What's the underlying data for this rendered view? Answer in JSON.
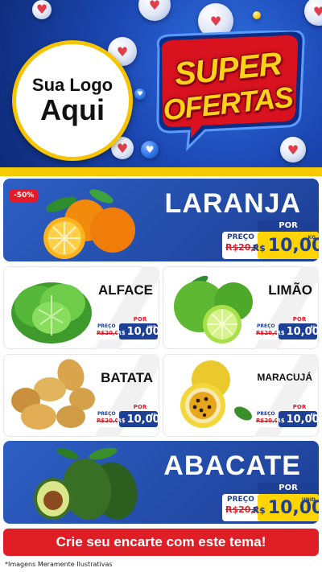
{
  "header": {
    "logo_line1": "Sua Logo",
    "logo_line2": "Aqui",
    "badge_line1": "SUPER",
    "badge_line2": "OFERTAS"
  },
  "products": {
    "laranja": {
      "name": "LARANJA",
      "discount": "-50%",
      "por": "POR",
      "preco": "PREÇO",
      "old": "R$20,00",
      "currency": "R$",
      "price": "10,00",
      "unit": "KG"
    },
    "alface": {
      "name": "ALFACE",
      "por": "POR",
      "preco": "PREÇO",
      "old": "R$20,00",
      "currency": "R$",
      "price": "10,00",
      "unit": "UNID"
    },
    "limao": {
      "name": "LIMÃO",
      "por": "POR",
      "preco": "PREÇO",
      "old": "R$20,00",
      "currency": "R$",
      "price": "10,00",
      "unit": "KG"
    },
    "batata": {
      "name": "BATATA",
      "por": "POR",
      "preco": "PREÇO",
      "old": "R$20,00",
      "currency": "R$",
      "price": "10,00",
      "unit": "KG"
    },
    "maracuja": {
      "name": "MARACUJÁ",
      "por": "POR",
      "preco": "PREÇO",
      "old": "R$20,00",
      "currency": "R$",
      "price": "10,00",
      "unit": "KG"
    },
    "abacate": {
      "name": "ABACATE",
      "por": "POR",
      "preco": "PREÇO",
      "old": "R$20,00",
      "currency": "R$",
      "price": "10,00",
      "unit": "UNID"
    }
  },
  "cta": "Crie seu encarte com este tema!",
  "disclaimer": "*Imagens Meramente Ilustrativas",
  "colors": {
    "primary_blue": "#1d3f95",
    "accent_yellow": "#ffd400",
    "accent_red": "#e01e26"
  }
}
